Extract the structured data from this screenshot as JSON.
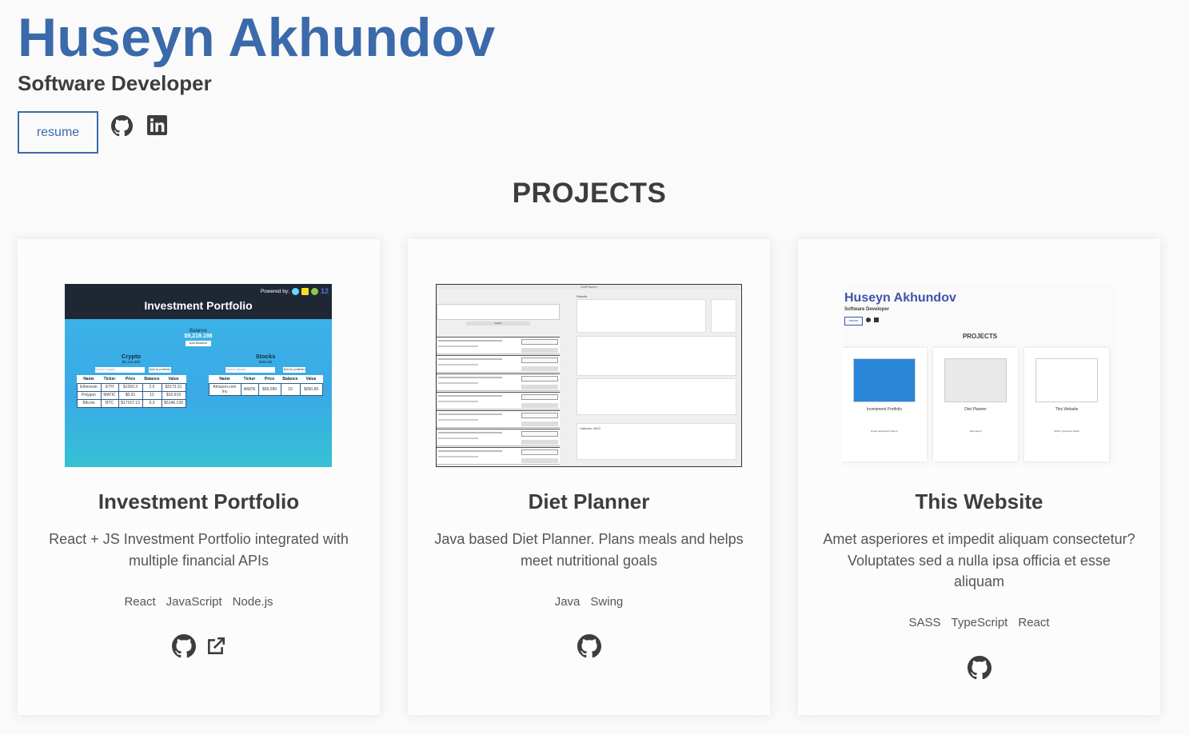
{
  "header": {
    "name": "Huseyn Akhundov",
    "role": "Software Developer",
    "resume_label": "resume",
    "github_icon": "github-icon",
    "linkedin_icon": "linkedin-icon"
  },
  "projects_title": "PROJECTS",
  "projects": [
    {
      "title": "Investment Portfolio",
      "description": "React + JS Investment Portfolio integrated with multiple financial APIs",
      "tags": [
        "React",
        "JavaScript",
        "Node.js"
      ],
      "links": [
        "github-icon",
        "external-link-icon"
      ],
      "screenshot": {
        "header": "Investment Portfolio",
        "powered_by": "Powered by:",
        "version": "12",
        "balance_label": "Balance",
        "balance_value": "$9,219.198",
        "balance_button": "Add Balance",
        "crypto_title": "Crypto",
        "crypto_value": "$5,164,990",
        "crypto_search": "Search crypto",
        "crypto_add": "Add to portfolio",
        "stocks_title": "Stocks",
        "stocks_value": "$990,89",
        "stocks_search": "Search stocks",
        "stocks_add": "Add to portfolio",
        "columns": [
          "Name",
          "Ticker",
          "Price",
          "Balance",
          "Value"
        ],
        "crypto_rows": [
          [
            "Ethereum",
            "ETH",
            "$1260.3",
            "2.5",
            "$3173.21"
          ],
          [
            "Polygon",
            "MATIC",
            "$0.91",
            "12",
            "$10.919"
          ],
          [
            "Bitcoin",
            "BTC",
            "$17167.13",
            "0.3",
            "$5146.139"
          ]
        ],
        "stock_rows": [
          [
            "Amazon.com Inc",
            "AMZN",
            "$99.089",
            "10",
            "$990.89"
          ]
        ]
      }
    },
    {
      "title": "Diet Planner",
      "description": "Java based Diet Planner. Plans meals and helps meet nutritional goals",
      "tags": [
        "Java",
        "Swing"
      ],
      "links": [
        "github-icon"
      ],
      "screenshot": {
        "window_title": "DietPlanner",
        "results_label": "Results",
        "calories_label": "Calories: 2813",
        "button_label": "submit"
      }
    },
    {
      "title": "This Website",
      "description": "Amet asperiores et impedit aliquam consectetur? Voluptates sed a nulla ipsa officia et esse aliquam",
      "tags": [
        "SASS",
        "TypeScript",
        "React"
      ],
      "links": [
        "github-icon"
      ],
      "screenshot": {
        "name": "Huseyn Akhundov",
        "role": "Software Developer",
        "resume": "resume",
        "projects": "PROJECTS",
        "cards": [
          "Investment Portfolio",
          "Diet Planner",
          "This Website"
        ],
        "tags": [
          [
            "React",
            "JavaScript",
            "Node.js"
          ],
          [
            "Java",
            "Swing"
          ],
          [
            "SASS",
            "TypeScript",
            "React"
          ]
        ]
      }
    }
  ],
  "colors": {
    "accent": "#3b6aab",
    "text": "#3d3d3d",
    "background": "#fafafa"
  }
}
